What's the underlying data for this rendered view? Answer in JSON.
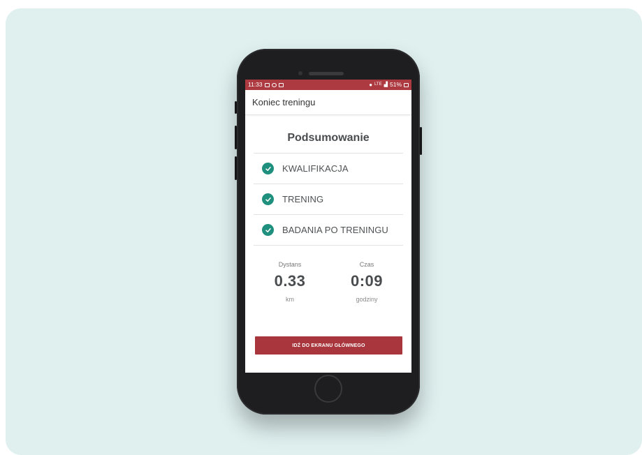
{
  "status_bar": {
    "time": "11:33",
    "battery": "51%",
    "signal": "LTE",
    "color": "#ad3a40"
  },
  "app_bar": {
    "title": "Koniec treningu"
  },
  "summary": {
    "heading": "Podsumowanie",
    "items": [
      {
        "label": "KWALIFIKACJA",
        "icon": "check-icon",
        "done": true
      },
      {
        "label": "TRENING",
        "icon": "check-icon",
        "done": true
      },
      {
        "label": "BADANIA PO TRENINGU",
        "icon": "check-icon",
        "done": true
      }
    ],
    "check_color": "#1f8f7e"
  },
  "stats": {
    "distance": {
      "label": "Dystans",
      "value": "0.33",
      "unit": "km"
    },
    "time": {
      "label": "Czas",
      "value": "0:09",
      "unit": "godziny"
    }
  },
  "action": {
    "button_label": "IDŹ DO EKRANU GŁÓWNEGO",
    "color": "#a8363c"
  }
}
